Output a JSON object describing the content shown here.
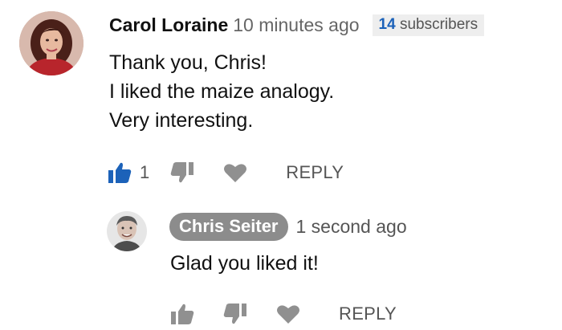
{
  "comment": {
    "author": "Carol Loraine",
    "timestamp": "10 minutes ago",
    "subscribers_count": "14",
    "subscribers_label": "subscribers",
    "lines": [
      "Thank you,  Chris!",
      "I liked the maize analogy.",
      "Very interesting."
    ],
    "like_count": "1",
    "reply_label": "REPLY",
    "liked": true,
    "icons": {
      "like": "thumbs-up-icon",
      "dislike": "thumbs-down-icon",
      "heart": "heart-icon"
    }
  },
  "reply": {
    "author": "Chris Seiter",
    "timestamp": "1 second ago",
    "text": "Glad you liked it!",
    "reply_label": "REPLY",
    "icons": {
      "like": "thumbs-up-icon",
      "dislike": "thumbs-down-icon",
      "heart": "heart-icon"
    }
  },
  "colors": {
    "liked_blue": "#1c62b9",
    "icon_gray": "#909090",
    "chip_gray": "#8c8c8c"
  }
}
